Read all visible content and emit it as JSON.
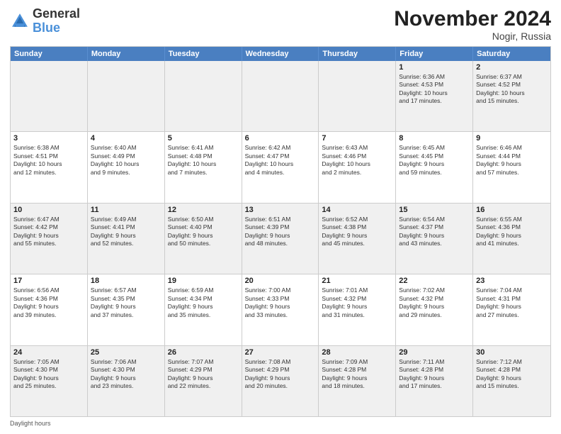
{
  "logo": {
    "general": "General",
    "blue": "Blue"
  },
  "title": "November 2024",
  "location": "Nogir, Russia",
  "days_of_week": [
    "Sunday",
    "Monday",
    "Tuesday",
    "Wednesday",
    "Thursday",
    "Friday",
    "Saturday"
  ],
  "footer": "Daylight hours",
  "weeks": [
    [
      {
        "day": "",
        "info": ""
      },
      {
        "day": "",
        "info": ""
      },
      {
        "day": "",
        "info": ""
      },
      {
        "day": "",
        "info": ""
      },
      {
        "day": "",
        "info": ""
      },
      {
        "day": "1",
        "info": "Sunrise: 6:36 AM\nSunset: 4:53 PM\nDaylight: 10 hours\nand 17 minutes."
      },
      {
        "day": "2",
        "info": "Sunrise: 6:37 AM\nSunset: 4:52 PM\nDaylight: 10 hours\nand 15 minutes."
      }
    ],
    [
      {
        "day": "3",
        "info": "Sunrise: 6:38 AM\nSunset: 4:51 PM\nDaylight: 10 hours\nand 12 minutes."
      },
      {
        "day": "4",
        "info": "Sunrise: 6:40 AM\nSunset: 4:49 PM\nDaylight: 10 hours\nand 9 minutes."
      },
      {
        "day": "5",
        "info": "Sunrise: 6:41 AM\nSunset: 4:48 PM\nDaylight: 10 hours\nand 7 minutes."
      },
      {
        "day": "6",
        "info": "Sunrise: 6:42 AM\nSunset: 4:47 PM\nDaylight: 10 hours\nand 4 minutes."
      },
      {
        "day": "7",
        "info": "Sunrise: 6:43 AM\nSunset: 4:46 PM\nDaylight: 10 hours\nand 2 minutes."
      },
      {
        "day": "8",
        "info": "Sunrise: 6:45 AM\nSunset: 4:45 PM\nDaylight: 9 hours\nand 59 minutes."
      },
      {
        "day": "9",
        "info": "Sunrise: 6:46 AM\nSunset: 4:44 PM\nDaylight: 9 hours\nand 57 minutes."
      }
    ],
    [
      {
        "day": "10",
        "info": "Sunrise: 6:47 AM\nSunset: 4:42 PM\nDaylight: 9 hours\nand 55 minutes."
      },
      {
        "day": "11",
        "info": "Sunrise: 6:49 AM\nSunset: 4:41 PM\nDaylight: 9 hours\nand 52 minutes."
      },
      {
        "day": "12",
        "info": "Sunrise: 6:50 AM\nSunset: 4:40 PM\nDaylight: 9 hours\nand 50 minutes."
      },
      {
        "day": "13",
        "info": "Sunrise: 6:51 AM\nSunset: 4:39 PM\nDaylight: 9 hours\nand 48 minutes."
      },
      {
        "day": "14",
        "info": "Sunrise: 6:52 AM\nSunset: 4:38 PM\nDaylight: 9 hours\nand 45 minutes."
      },
      {
        "day": "15",
        "info": "Sunrise: 6:54 AM\nSunset: 4:37 PM\nDaylight: 9 hours\nand 43 minutes."
      },
      {
        "day": "16",
        "info": "Sunrise: 6:55 AM\nSunset: 4:36 PM\nDaylight: 9 hours\nand 41 minutes."
      }
    ],
    [
      {
        "day": "17",
        "info": "Sunrise: 6:56 AM\nSunset: 4:36 PM\nDaylight: 9 hours\nand 39 minutes."
      },
      {
        "day": "18",
        "info": "Sunrise: 6:57 AM\nSunset: 4:35 PM\nDaylight: 9 hours\nand 37 minutes."
      },
      {
        "day": "19",
        "info": "Sunrise: 6:59 AM\nSunset: 4:34 PM\nDaylight: 9 hours\nand 35 minutes."
      },
      {
        "day": "20",
        "info": "Sunrise: 7:00 AM\nSunset: 4:33 PM\nDaylight: 9 hours\nand 33 minutes."
      },
      {
        "day": "21",
        "info": "Sunrise: 7:01 AM\nSunset: 4:32 PM\nDaylight: 9 hours\nand 31 minutes."
      },
      {
        "day": "22",
        "info": "Sunrise: 7:02 AM\nSunset: 4:32 PM\nDaylight: 9 hours\nand 29 minutes."
      },
      {
        "day": "23",
        "info": "Sunrise: 7:04 AM\nSunset: 4:31 PM\nDaylight: 9 hours\nand 27 minutes."
      }
    ],
    [
      {
        "day": "24",
        "info": "Sunrise: 7:05 AM\nSunset: 4:30 PM\nDaylight: 9 hours\nand 25 minutes."
      },
      {
        "day": "25",
        "info": "Sunrise: 7:06 AM\nSunset: 4:30 PM\nDaylight: 9 hours\nand 23 minutes."
      },
      {
        "day": "26",
        "info": "Sunrise: 7:07 AM\nSunset: 4:29 PM\nDaylight: 9 hours\nand 22 minutes."
      },
      {
        "day": "27",
        "info": "Sunrise: 7:08 AM\nSunset: 4:29 PM\nDaylight: 9 hours\nand 20 minutes."
      },
      {
        "day": "28",
        "info": "Sunrise: 7:09 AM\nSunset: 4:28 PM\nDaylight: 9 hours\nand 18 minutes."
      },
      {
        "day": "29",
        "info": "Sunrise: 7:11 AM\nSunset: 4:28 PM\nDaylight: 9 hours\nand 17 minutes."
      },
      {
        "day": "30",
        "info": "Sunrise: 7:12 AM\nSunset: 4:28 PM\nDaylight: 9 hours\nand 15 minutes."
      }
    ]
  ]
}
